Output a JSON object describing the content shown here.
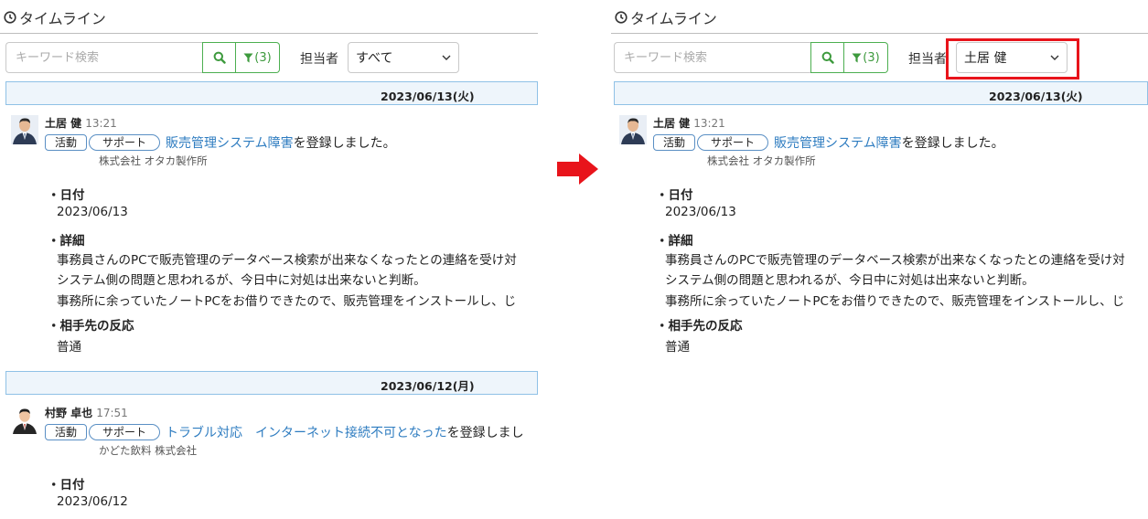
{
  "timeline_title": "タイムライン",
  "search": {
    "placeholder": "キーワード検索",
    "filter_count": "(3)"
  },
  "assignee_label": "担当者",
  "before": {
    "assignee_value": "すべて"
  },
  "after": {
    "assignee_value": "土居 健"
  },
  "colors": {
    "accent_green": "#4caf50",
    "link_blue": "#2e7cc0",
    "date_bar_border": "#8fc1e6",
    "highlight_red": "#e8141b"
  },
  "dates": [
    "2023/06/13(火)",
    "2023/06/12(月)"
  ],
  "entries": [
    {
      "author": "土居 健",
      "time": "13:21",
      "tags": [
        "活動",
        "サポート"
      ],
      "link": "販売管理システム障害",
      "suffix": "を登録しました。",
      "company": "株式会社 オタカ製作所",
      "fields": {
        "date_label": "・日付",
        "date_value": "2023/06/13",
        "detail_label": "・詳細",
        "detail_lines": [
          "事務員さんのPCで販売管理のデータベース検索が出来なくなったとの連絡を受け対",
          "システム側の問題と思われるが、今日中に対処は出来ないと判断。",
          "事務所に余っていたノートPCをお借りできたので、販売管理をインストールし、じ"
        ],
        "reaction_label": "・相手先の反応",
        "reaction_value": "普通"
      }
    },
    {
      "author": "村野 卓也",
      "time": "17:51",
      "tags": [
        "活動",
        "サポート"
      ],
      "link": "トラブル対応　インターネット接続不可となった",
      "suffix": "を登録しまし",
      "company": "かどた飲料 株式会社",
      "fields": {
        "date_label": "・日付",
        "date_value": "2023/06/12"
      }
    }
  ]
}
